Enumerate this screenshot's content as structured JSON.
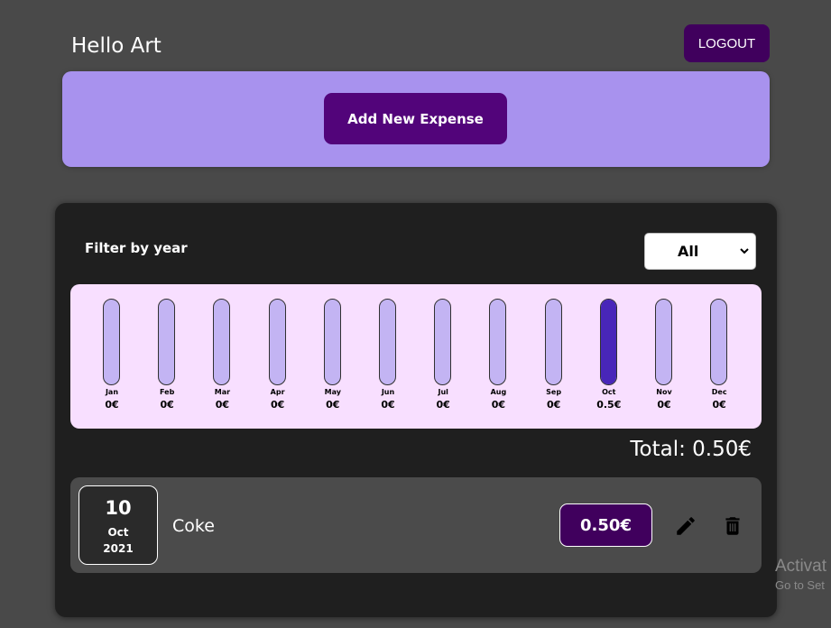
{
  "header": {
    "greeting": "Hello Art",
    "logout_label": "LOGOUT"
  },
  "add_panel": {
    "button_label": "Add New Expense"
  },
  "filter": {
    "label": "Filter by year",
    "selected": "All"
  },
  "chart_data": {
    "type": "bar",
    "categories": [
      "Jan",
      "Feb",
      "Mar",
      "Apr",
      "May",
      "Jun",
      "Jul",
      "Aug",
      "Sep",
      "Oct",
      "Nov",
      "Dec"
    ],
    "values": [
      0,
      0,
      0,
      0,
      0,
      0,
      0,
      0,
      0,
      0.5,
      0,
      0
    ],
    "value_labels": [
      "0€",
      "0€",
      "0€",
      "0€",
      "0€",
      "0€",
      "0€",
      "0€",
      "0€",
      "0.5€",
      "0€",
      "0€"
    ],
    "max": 0.5,
    "fill_color": "#4826b9",
    "track_color": "#c3b4f3"
  },
  "total": {
    "text": "Total: 0.50€"
  },
  "expenses": [
    {
      "day": "10",
      "month": "Oct",
      "year": "2021",
      "title": "Coke",
      "amount": "0.50€",
      "edit_icon": "pencil-icon",
      "delete_icon": "trash-icon"
    }
  ],
  "watermark": {
    "line1": "Activat",
    "line2": "Go to Set"
  }
}
